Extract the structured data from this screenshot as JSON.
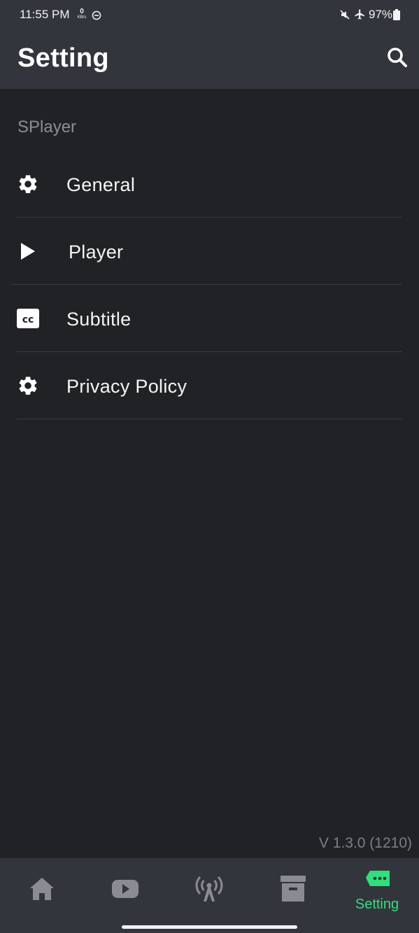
{
  "status_bar": {
    "time": "11:55 PM",
    "net_speed": "0",
    "net_unit": "KB/s",
    "battery": "97%"
  },
  "header": {
    "title": "Setting",
    "search_icon": "search-icon"
  },
  "section": {
    "label": "SPlayer"
  },
  "menu": {
    "items": [
      {
        "label": "General",
        "icon": "gear-icon"
      },
      {
        "label": "Player",
        "icon": "play-icon"
      },
      {
        "label": "Subtitle",
        "icon": "closed-caption-icon"
      },
      {
        "label": "Privacy Policy",
        "icon": "gear-icon"
      }
    ]
  },
  "version": "V 1.3.0 (1210)",
  "bottom_nav": {
    "items": [
      {
        "icon": "home-icon"
      },
      {
        "icon": "youtube-icon"
      },
      {
        "icon": "broadcast-icon"
      },
      {
        "icon": "archive-icon"
      },
      {
        "icon": "chat-more-icon",
        "label": "Setting"
      }
    ],
    "active_color": "#2fe07a",
    "inactive_color": "#8a8b93"
  },
  "colors": {
    "background": "#212226",
    "bar": "#33353d",
    "accent": "#2fe07a"
  }
}
